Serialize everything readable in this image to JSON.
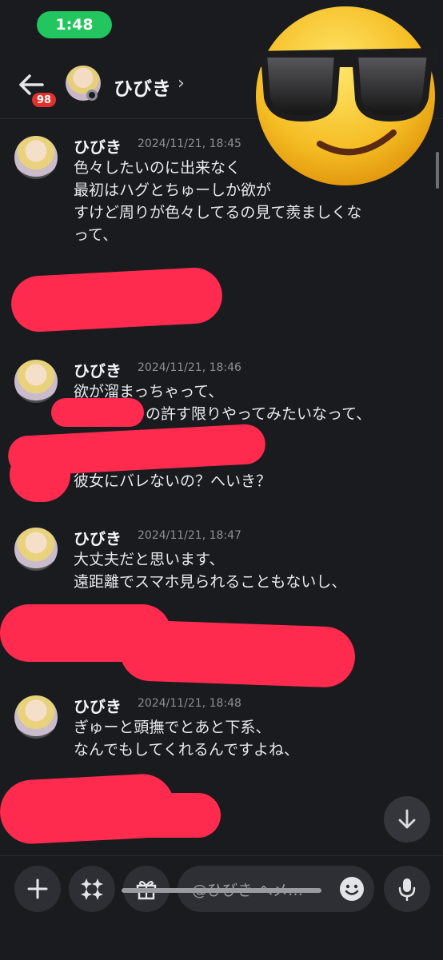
{
  "status_bar": {
    "time": "1:48",
    "time_pill_color": "#22c55e"
  },
  "header": {
    "back_icon": "arrow-left-icon",
    "unread_badge": "98",
    "title": "ひびき",
    "chevron": "›"
  },
  "messages": [
    {
      "author": "ひびき",
      "timestamp": "2024/11/21, 18:45",
      "lines": [
        "色々したいのに出来なく",
        "最初はハグとちゅーしか欲が",
        "すけど周りが色々してるの見て羨ましくな",
        "って、"
      ]
    },
    {
      "author": "ひびき",
      "timestamp": "2024/11/21, 18:46",
      "lines": [
        "欲が溜まっちゃって、",
        "の許す限りやってみたいなって、"
      ]
    },
    {
      "author": "",
      "timestamp": "",
      "lines": [
        "彼女にバレないの？へいき？"
      ]
    },
    {
      "author": "ひびき",
      "timestamp": "2024/11/21, 18:47",
      "lines": [
        "大丈夫だと思います、",
        "遠距離でスマホ見られることもないし、"
      ]
    },
    {
      "author": "ひびき",
      "timestamp": "2024/11/21, 18:48",
      "lines": [
        "ぎゅーと頭撫でとあと下系、",
        "なんでもしてくれるんですよね、"
      ]
    }
  ],
  "overlay": {
    "emoji": "smiling-face-with-sunglasses",
    "redaction_color": "#ff2b4f"
  },
  "jump_to_latest": {
    "icon": "arrow-down-icon"
  },
  "composer": {
    "buttons": [
      "plus-icon",
      "sparkle-apps-icon",
      "gift-icon"
    ],
    "placeholder": "@ひびき へメ…",
    "emoji_icon": "smiley-icon",
    "mic_icon": "microphone-icon"
  }
}
